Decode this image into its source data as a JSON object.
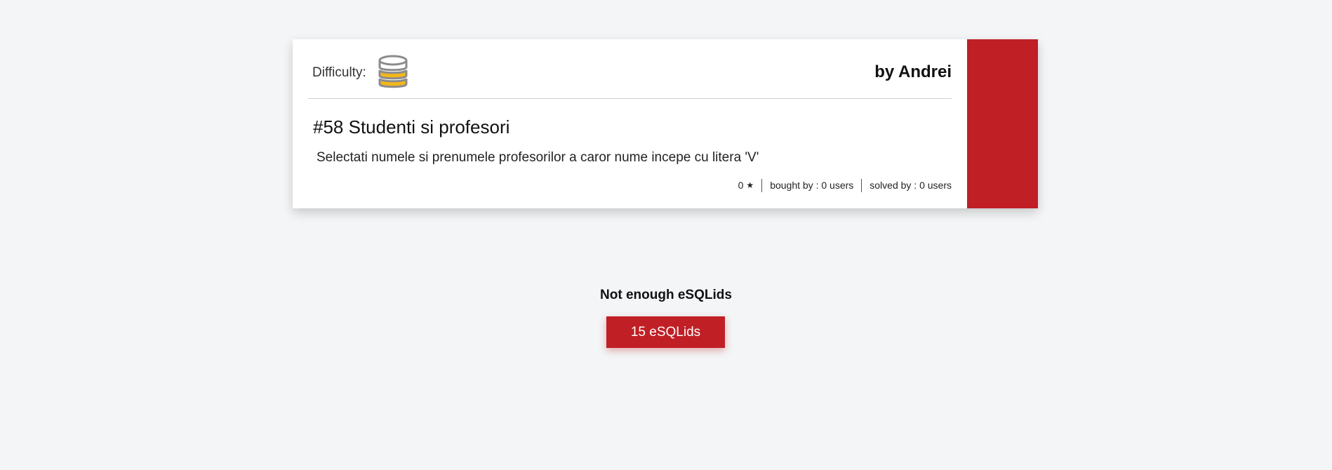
{
  "card": {
    "difficulty_label": "Difficulty:",
    "difficulty_icon": "database-icon",
    "author": "by Andrei",
    "title": "#58 Studenti si profesori",
    "description": "Selectati numele si prenumele profesorilor a caror nume incepe cu litera 'V'",
    "stats": {
      "stars": "0",
      "star_glyph": "★",
      "bought": "bought by : 0 users",
      "solved": "solved by : 0 users"
    }
  },
  "purchase": {
    "notice": "Not enough eSQLids",
    "button_label": "15 eSQLids"
  },
  "colors": {
    "accent": "#c01f25",
    "difficulty_fill": "#f2b71a",
    "background": "#f3f5f6"
  }
}
